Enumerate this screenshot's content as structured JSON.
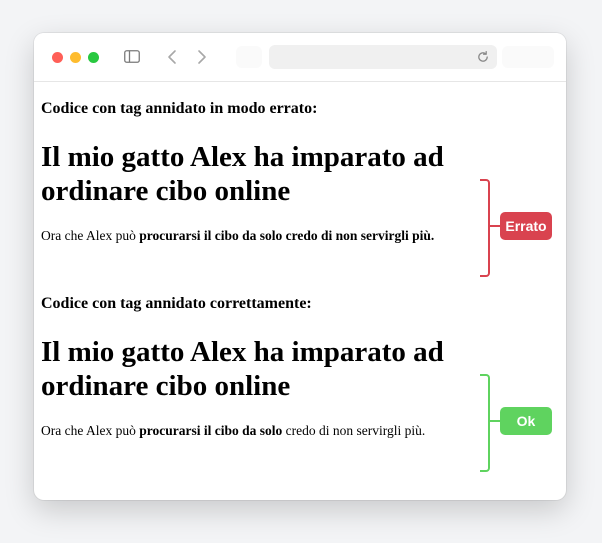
{
  "browser": {
    "controls": {
      "close_color": "#ff5f57",
      "minimize_color": "#febc2e",
      "zoom_color": "#28c840"
    },
    "icons": {
      "sidebar": "sidebar-icon",
      "back": "chevron-left-icon",
      "forward": "chevron-right-icon",
      "reload": "reload-icon"
    }
  },
  "wrong_example": {
    "label": "Codice con tag annidato in modo errato:",
    "heading": "Il mio gatto Alex ha imparato ad ordinare cibo online",
    "para_prefix": "Ora che Alex può ",
    "para_bold": "procurarsi il cibo da solo credo di non servirgli più.",
    "badge": "Errato",
    "color": "#d9434f"
  },
  "right_example": {
    "label": "Codice con tag annidato correttamente:",
    "heading": "Il mio gatto Alex ha imparato ad ordinare cibo online",
    "para_prefix": "Ora che Alex può ",
    "para_bold": "procurarsi il cibo da solo",
    "para_suffix": " credo di non servirgli più.",
    "badge": "Ok",
    "color": "#5fd35f"
  }
}
